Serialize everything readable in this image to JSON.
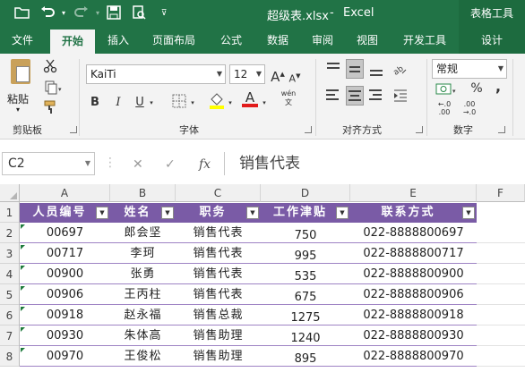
{
  "window": {
    "file_title": "超级表.xlsx",
    "separator": "-",
    "app_name": "Excel",
    "context_group": "表格工具"
  },
  "tabs": [
    {
      "label": "文件"
    },
    {
      "label": "开始"
    },
    {
      "label": "插入"
    },
    {
      "label": "页面布局"
    },
    {
      "label": "公式"
    },
    {
      "label": "数据"
    },
    {
      "label": "审阅"
    },
    {
      "label": "视图"
    },
    {
      "label": "开发工具"
    },
    {
      "label": "设计"
    }
  ],
  "ribbon": {
    "paste_label": "粘贴",
    "font_name": "KaiTi",
    "font_size": "12",
    "number_format": "常规",
    "groups": {
      "clipboard": "剪贴板",
      "font": "字体",
      "alignment": "对齐方式",
      "number": "数字"
    },
    "bold": "B",
    "italic": "I",
    "underline": "U",
    "percent": "%",
    "comma": ",",
    "decimal_inc": "←.0\n.00",
    "decimal_dec": ".00\n→.0",
    "font_grow": "A",
    "font_shrink": "A",
    "font_color": "A",
    "wen": "wén"
  },
  "formula_bar": {
    "name_box": "C2",
    "fx": "fx",
    "value": "销售代表"
  },
  "grid": {
    "columns": [
      "A",
      "B",
      "C",
      "D",
      "E",
      "F"
    ],
    "rows": [
      "1",
      "2",
      "3",
      "4",
      "5",
      "6",
      "7",
      "8"
    ],
    "headers": [
      "人员编号",
      "姓名",
      "职务",
      "工作津贴",
      "联系方式"
    ],
    "data": [
      [
        "00697",
        "郎会坚",
        "销售代表",
        "750",
        "022-8888800697"
      ],
      [
        "00717",
        "李珂",
        "销售代表",
        "995",
        "022-8888800717"
      ],
      [
        "00900",
        "张勇",
        "销售代表",
        "535",
        "022-8888800900"
      ],
      [
        "00906",
        "王丙柱",
        "销售代表",
        "675",
        "022-8888800906"
      ],
      [
        "00918",
        "赵永福",
        "销售总裁",
        "1275",
        "022-8888800918"
      ],
      [
        "00930",
        "朱体高",
        "销售助理",
        "1240",
        "022-8888800930"
      ],
      [
        "00970",
        "王俊松",
        "销售助理",
        "895",
        "022-8888800970"
      ]
    ]
  },
  "colors": {
    "excel_green": "#217346",
    "table_header": "#7a5ba6"
  }
}
